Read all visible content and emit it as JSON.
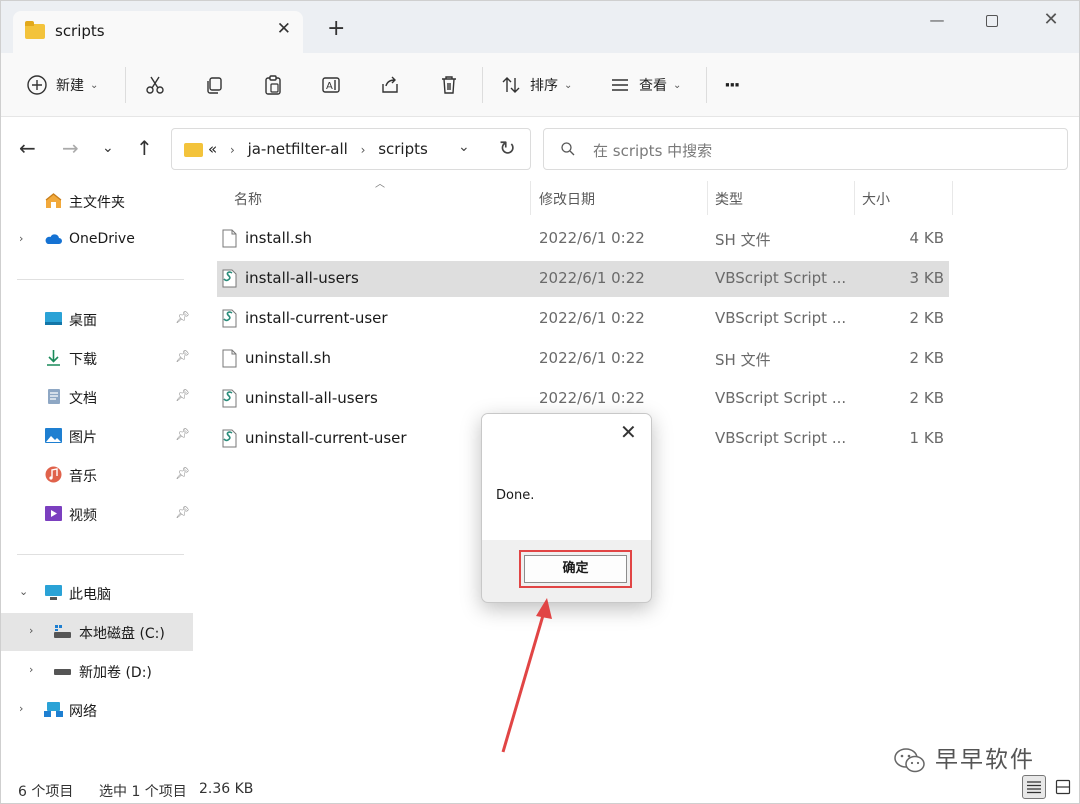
{
  "tab": {
    "title": "scripts"
  },
  "toolbar": {
    "new_label": "新建",
    "sort_label": "排序",
    "view_label": "查看",
    "more_label": "···"
  },
  "address": {
    "overflow": "«",
    "crumb1": "ja-netfilter-all",
    "crumb2": "scripts"
  },
  "search": {
    "placeholder": "在 scripts 中搜索"
  },
  "sidebar": {
    "home": "主文件夹",
    "onedrive": "OneDrive",
    "desktop": "桌面",
    "downloads": "下载",
    "documents": "文档",
    "pictures": "图片",
    "music": "音乐",
    "videos": "视频",
    "thispc": "此电脑",
    "drive_c": "本地磁盘 (C:)",
    "drive_d": "新加卷 (D:)",
    "network": "网络"
  },
  "columns": {
    "name": "名称",
    "modified": "修改日期",
    "type": "类型",
    "size": "大小"
  },
  "files": [
    {
      "name": "install.sh",
      "date": "2022/6/1 0:22",
      "type": "SH 文件",
      "size": "4 KB",
      "icon": "file-icon"
    },
    {
      "name": "install-all-users",
      "date": "2022/6/1 0:22",
      "type": "VBScript Script ...",
      "size": "3 KB",
      "icon": "vbscript-icon"
    },
    {
      "name": "install-current-user",
      "date": "2022/6/1 0:22",
      "type": "VBScript Script ...",
      "size": "2 KB",
      "icon": "vbscript-icon"
    },
    {
      "name": "uninstall.sh",
      "date": "2022/6/1 0:22",
      "type": "SH 文件",
      "size": "2 KB",
      "icon": "file-icon"
    },
    {
      "name": "uninstall-all-users",
      "date": "2022/6/1 0:22",
      "type": "VBScript Script ...",
      "size": "2 KB",
      "icon": "vbscript-icon"
    },
    {
      "name": "uninstall-current-user",
      "date": "",
      "type": "VBScript Script ...",
      "size": "1 KB",
      "icon": "vbscript-icon"
    }
  ],
  "status": {
    "count": "6 个项目",
    "selected": "选中 1 个项目",
    "size": "2.36 KB"
  },
  "dialog": {
    "message": "Done.",
    "ok_label": "确定"
  },
  "watermark": "早早软件",
  "colors": {
    "highlight_red": "#e14545",
    "folder": "#f3c33b",
    "selection": "#dedede"
  }
}
